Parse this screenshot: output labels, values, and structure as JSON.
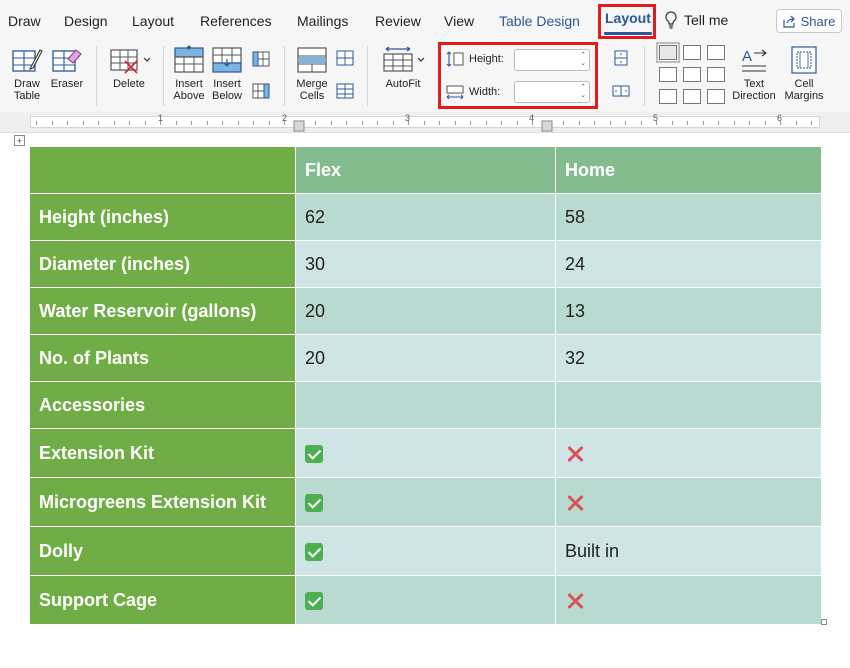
{
  "tabs": [
    "Draw",
    "Design",
    "Layout",
    "References",
    "Mailings",
    "Review",
    "View",
    "Table Design",
    "Layout"
  ],
  "tell_me": "Tell me",
  "share": "Share",
  "ribbon": {
    "draw_table": "Draw\nTable",
    "eraser": "Eraser",
    "delete": "Delete",
    "insert_above": "Insert\nAbove",
    "insert_below": "Insert\nBelow",
    "merge_cells": "Merge\nCells",
    "autofit": "AutoFit",
    "height_label": "Height:",
    "width_label": "Width:",
    "height_value": "",
    "width_value": "",
    "text_direction": "Text\nDirection",
    "cell_margins": "Cell\nMargins"
  },
  "ruler": {
    "numbers": [
      "1",
      "2",
      "3",
      "4",
      "5",
      "6"
    ]
  },
  "table": {
    "headers": [
      "",
      "Flex",
      "Home"
    ],
    "rows": [
      {
        "label": "Height (inches)",
        "flex": "62",
        "home": "58"
      },
      {
        "label": "Diameter (inches)",
        "flex": "30",
        "home": "24"
      },
      {
        "label": "Water Reservoir (gallons)",
        "flex": "20",
        "home": "13"
      },
      {
        "label": "No. of Plants",
        "flex": "20",
        "home": "32"
      },
      {
        "label": "Accessories",
        "flex": "",
        "home": ""
      },
      {
        "label": "Extension Kit",
        "flex": "check",
        "home": "cross"
      },
      {
        "label": "Microgreens Extension Kit",
        "flex": "check",
        "home": "cross"
      },
      {
        "label": "Dolly",
        "flex": "check",
        "home": "Built in"
      },
      {
        "label": "Support Cage",
        "flex": "check",
        "home": "cross"
      }
    ]
  },
  "colors": {
    "row_header_green": "#70ad47",
    "column_header_green": "#84bb8f",
    "cell_band_a": "#b9dad1",
    "cell_band_b": "#cfe5e5",
    "accent_blue": "#2b579a",
    "highlight_red": "#e11c1c",
    "check_green": "#4caf50",
    "cross_red": "#d9535a"
  }
}
